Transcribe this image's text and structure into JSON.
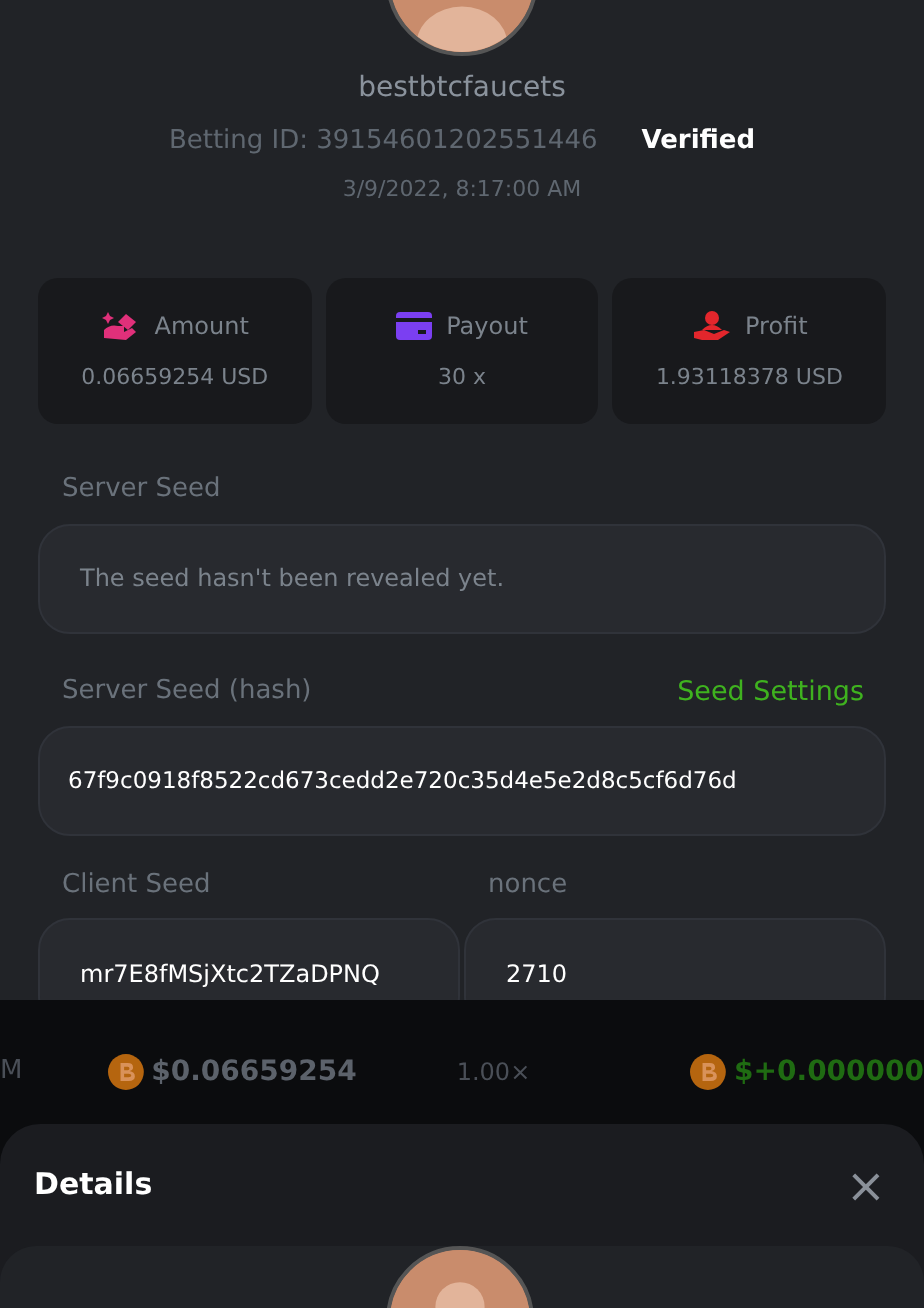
{
  "bet": {
    "username": "bestbtcfaucets",
    "betting_id": "Betting ID: 39154601202551446",
    "status": "Verified",
    "date": "3/9/2022, 8:17:00 AM"
  },
  "stats": [
    {
      "kind": "amount",
      "label": "Amount",
      "value": "0.06659254 USD"
    },
    {
      "kind": "payout",
      "label": "Payout",
      "value": "30 x"
    },
    {
      "kind": "profit",
      "label": "Profit",
      "value": "1.93118378 USD"
    }
  ],
  "server_seed": {
    "label": "Server Seed",
    "message": "The seed hasn't been revealed yet."
  },
  "server_seed_hash": {
    "label": "Server Seed (hash)",
    "link": "Seed Settings",
    "value": "67f9c0918f8522cd673cedd2e720c35d4e5e2d8c5cf6d76d"
  },
  "client_seed": {
    "label": "Client Seed",
    "value": "mr7E8fMSjXtc2TZaDPNQ"
  },
  "nonce": {
    "label": "nonce",
    "value": "2710"
  },
  "background_row": {
    "time": "M",
    "amount": "$0.06659254",
    "multiplier": "1.00×",
    "profit": "$+0.000000"
  },
  "sheet": {
    "title": "Details",
    "close": "×"
  }
}
